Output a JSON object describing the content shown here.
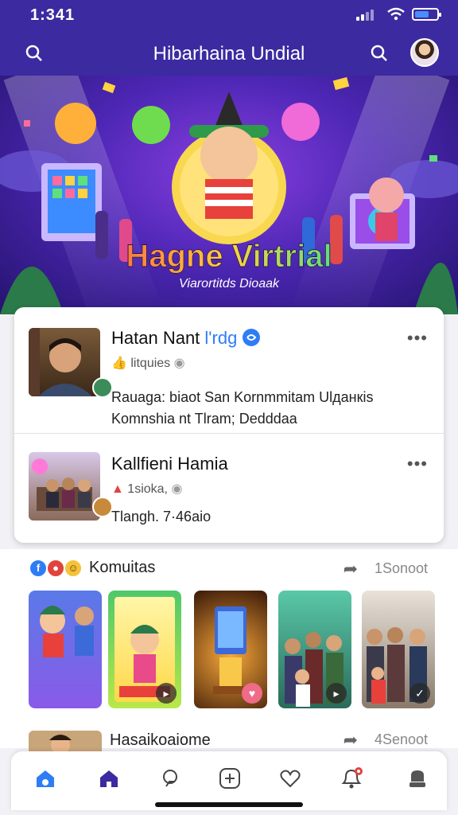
{
  "status_bar": {
    "time": "1:341",
    "battery_level": 0.55
  },
  "header": {
    "title": "Hibarhaina Undial"
  },
  "hero": {
    "title": "Hagne Virtrial",
    "subtitle": "Viarortitds Dioaak"
  },
  "posts": [
    {
      "name": "Hatan Nant",
      "name_suffix": "l'rdg",
      "meta": "litquies",
      "body": "Rauaga: biaot San Kornmmitam Ulданкis Komnshia nt Tlram; Dedddaa"
    },
    {
      "name": "Kallfieni Hamia",
      "meta": "1sioka,",
      "body": "Tlangh. 7·46aio"
    }
  ],
  "community": {
    "title": "Komuitas",
    "count": "1Sonoot"
  },
  "next_row": {
    "name": "Hasaikoaiome",
    "count": "4Senoot"
  },
  "colors": {
    "brand": "#3c2aa0",
    "verified": "#2f7df6",
    "accent_red": "#e0443c"
  },
  "icons": [
    "search-icon",
    "profile-avatar",
    "more-icon",
    "share-icon",
    "home-icon",
    "explore-icon",
    "add-icon",
    "heart-icon",
    "notification-icon",
    "menu-icon"
  ]
}
